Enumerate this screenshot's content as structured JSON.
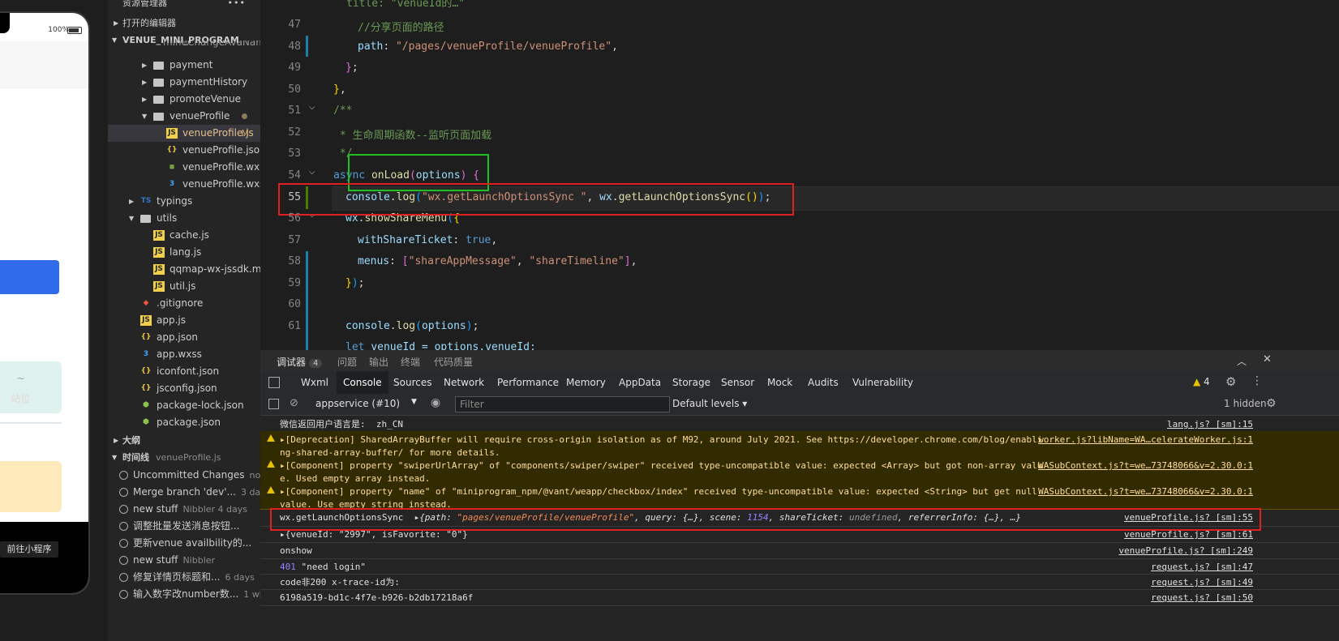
{
  "simulator": {
    "battery": "100%",
    "card_line1": "~",
    "card_line2": "站位",
    "goto_label": "前往小程序"
  },
  "explorer": {
    "title": "资源管理器",
    "open_editors": "打开的编辑器",
    "project": "VENUE_MINI_PROGRAM",
    "truncated_item": "mineChangeAvaName...",
    "items": [
      {
        "label": "payment",
        "type": "folder",
        "depth": 1
      },
      {
        "label": "paymentHistory",
        "type": "folder",
        "depth": 1
      },
      {
        "label": "promoteVenue",
        "type": "folder",
        "depth": 1
      },
      {
        "label": "venueProfile",
        "type": "folder-open",
        "depth": 1
      },
      {
        "label": "venueProfile.js",
        "type": "js",
        "depth": 2,
        "badge": "M"
      },
      {
        "label": "venueProfile.json",
        "type": "json",
        "depth": 2
      },
      {
        "label": "venueProfile.wxml",
        "type": "wxml",
        "depth": 2
      },
      {
        "label": "venueProfile.wxss",
        "type": "wxss",
        "depth": 2
      },
      {
        "label": "typings",
        "type": "ts-folder",
        "depth": 0
      },
      {
        "label": "utils",
        "type": "folder-open",
        "depth": 0
      },
      {
        "label": "cache.js",
        "type": "js",
        "depth": 1
      },
      {
        "label": "lang.js",
        "type": "js",
        "depth": 1
      },
      {
        "label": "qqmap-wx-jssdk.min.js",
        "type": "js",
        "depth": 1
      },
      {
        "label": "util.js",
        "type": "js",
        "depth": 1
      },
      {
        "label": ".gitignore",
        "type": "git",
        "depth": 0
      },
      {
        "label": "app.js",
        "type": "js",
        "depth": 0
      },
      {
        "label": "app.json",
        "type": "json",
        "depth": 0
      },
      {
        "label": "app.wxss",
        "type": "wxss",
        "depth": 0
      },
      {
        "label": "iconfont.json",
        "type": "json",
        "depth": 0
      },
      {
        "label": "jsconfig.json",
        "type": "json",
        "depth": 0
      },
      {
        "label": "package-lock.json",
        "type": "pkg",
        "depth": 0
      },
      {
        "label": "package.json",
        "type": "pkg",
        "depth": 0
      }
    ],
    "outline": "大纲",
    "timeline": "时间线",
    "timeline_file": "venueProfile.js",
    "timeline_items": [
      {
        "text": "Uncommitted Changes",
        "who": "now"
      },
      {
        "text": "Merge branch 'dev'...",
        "who": "3 days"
      },
      {
        "text": "new stuff",
        "who": "Nibbler 4 days"
      },
      {
        "text": "调整批量发送消息按钮...",
        "who": ""
      },
      {
        "text": "更新venue availbility的...",
        "who": ""
      },
      {
        "text": "new stuff",
        "who": "Nibbler"
      },
      {
        "text": "修复详情页标题和...",
        "who": "6 days"
      },
      {
        "text": "输入数字改number数...",
        "who": "1 wk"
      }
    ]
  },
  "editor": {
    "line_numbers": [
      "47",
      "48",
      "49",
      "50",
      "51",
      "52",
      "53",
      "54",
      "55",
      "56",
      "57",
      "58",
      "59",
      "60",
      "61"
    ],
    "comment_share_path": "//分享页面的路径",
    "path_key": "path",
    "path_value": "\"/pages/venueProfile/venueProfile\"",
    "jsdoc_open": "/**",
    "jsdoc_line": " * 生命周期函数--监听页面加载",
    "jsdoc_close": " */",
    "onload_async": "async",
    "onload_name": "onLoad",
    "onload_param": "options",
    "console": "console",
    "log": "log",
    "log_str": "\"wx.getLaunchOptionsSync \"",
    "wx": "wx",
    "get_launch": "getLaunchOptionsSync",
    "show_share": "showShareMenu",
    "with_ticket": "withShareTicket",
    "bool_true": "true",
    "menus_key": "menus",
    "menu1": "\"shareAppMessage\"",
    "menu2": "\"shareTimeline\"",
    "let_kw": "let",
    "venue_id_line": "venueId = options.venueId;"
  },
  "devtools": {
    "top_tabs": [
      {
        "label": "调试器",
        "count": "4"
      },
      {
        "label": "问题"
      },
      {
        "label": "输出"
      },
      {
        "label": "终端"
      },
      {
        "label": "代码质量"
      }
    ],
    "panel_tabs": [
      "Wxml",
      "Console",
      "Sources",
      "Network",
      "Performance",
      "Memory",
      "AppData",
      "Storage",
      "Sensor",
      "Mock",
      "Audits",
      "Vulnerability"
    ],
    "warn_count": "4",
    "context": "appservice (#10)",
    "filter_placeholder": "Filter",
    "levels": "Default levels",
    "hidden": "1 hidden",
    "logs": [
      {
        "msg": "微信返回用户语言是:  zh_CN",
        "src": "lang.js? [sm]:15",
        "type": "log"
      },
      {
        "msg": "▸[Deprecation] SharedArrayBuffer will require cross-origin isolation as of M92, around July 2021. See https://developer.chrome.com/blog/enabling-shared-array-buffer/ for more details.",
        "src": "worker.js?libName=WA…celerateWorker.js:1",
        "type": "warn"
      },
      {
        "msg": "▸[Component] property \"swiperUrlArray\" of \"components/swiper/swiper\" received type-uncompatible value: expected <Array> but got non-array value. Used empty array instead.",
        "src": "WASubContext.js?t=we…73748066&v=2.30.0:1",
        "type": "warn"
      },
      {
        "msg": "▸[Component] property \"name\" of \"miniprogram_npm/@vant/weapp/checkbox/index\" received type-uncompatible value: expected <String> but get null value. Use empty string instead.",
        "src": "WASubContext.js?t=we…73748066&v=2.30.0:1",
        "type": "warn"
      },
      {
        "msg": "wx.getLaunchOptionsSync",
        "src": "venueProfile.js? [sm]:55",
        "type": "log"
      },
      {
        "msg": "▸{venueId: \"2997\", isFavorite: \"0\"}",
        "src": "venueProfile.js? [sm]:61",
        "type": "log"
      },
      {
        "msg": "onshow",
        "src": "venueProfile.js? [sm]:249",
        "type": "log"
      },
      {
        "msg": "401 \"need login\"",
        "src": "request.js? [sm]:47",
        "type": "log"
      },
      {
        "msg": "code非200 x-trace-id为:",
        "src": "request.js? [sm]:49",
        "type": "log"
      },
      {
        "msg": "6198a519-bd1c-4f7e-b926-b2db17218a6f",
        "src": "request.js? [sm]:50",
        "type": "log"
      }
    ],
    "launch_obj": {
      "path_key": "path",
      "path_val": "\"pages/venueProfile/venueProfile\"",
      "query_key": "query",
      "query_val": "{…}",
      "scene_key": "scene",
      "scene_val": "1154",
      "ticket_key": "shareTicket",
      "ticket_val": "undefined",
      "ref_key": "referrerInfo",
      "ref_val": "{…}"
    }
  }
}
